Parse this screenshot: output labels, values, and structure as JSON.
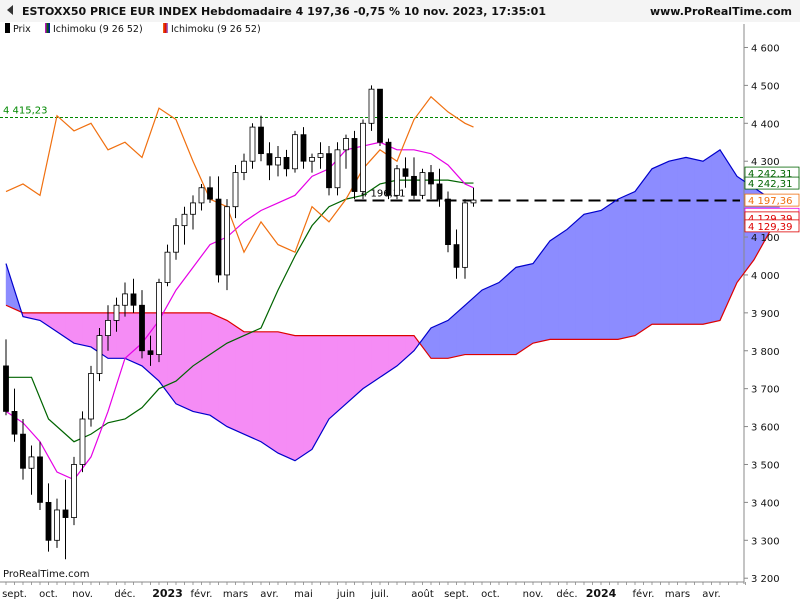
{
  "header": {
    "title": "ESTOXX50 PRICE EUR INDEX Hebdomadaire 4 197,36 -0,75 % 10 nov. 2023, 17:35:01",
    "brand": "www.ProRealTime.com"
  },
  "legend": [
    {
      "label": "Prix",
      "color": "#000000"
    },
    {
      "label": "Ichimoku (9 26 52)",
      "color": "#8a2be2"
    },
    {
      "label": "Ichimoku (9 26 52)",
      "color": "#8a2be2"
    }
  ],
  "footer": {
    "platform": "ProRealTime.com"
  },
  "colors": {
    "tenkan": "#e600e6",
    "kijun": "#006400",
    "chikou": "#f07010",
    "span_a": "#0000cc",
    "span_b": "#dd0000",
    "cloud_bull": "#8c8cff",
    "cloud_bear": "#f58cf5",
    "up_candle": "#ffffff",
    "down_candle": "#000000",
    "ref_line": "#008800"
  },
  "chart_data": {
    "type": "candlestick",
    "ylim": [
      3190,
      4625
    ],
    "y_ticks": [
      "4 600",
      "4 500",
      "4 400",
      "4 300",
      "4 200",
      "4 100",
      "4 000",
      "3 900",
      "3 800",
      "3 700",
      "3 600",
      "3 500",
      "3 400",
      "3 300",
      "3 200"
    ],
    "x_labels": [
      {
        "label": "sept.",
        "bar": 1,
        "bold": false
      },
      {
        "label": "oct.",
        "bar": 5,
        "bold": false
      },
      {
        "label": "nov.",
        "bar": 9,
        "bold": false
      },
      {
        "label": "déc.",
        "bar": 14,
        "bold": false
      },
      {
        "label": "2023",
        "bar": 19,
        "bold": true
      },
      {
        "label": "févr.",
        "bar": 23,
        "bold": false
      },
      {
        "label": "mars",
        "bar": 27,
        "bold": false
      },
      {
        "label": "avr.",
        "bar": 31,
        "bold": false
      },
      {
        "label": "mai",
        "bar": 35,
        "bold": false
      },
      {
        "label": "juin",
        "bar": 40,
        "bold": false
      },
      {
        "label": "juil.",
        "bar": 44,
        "bold": false
      },
      {
        "label": "août",
        "bar": 49,
        "bold": false
      },
      {
        "label": "sept.",
        "bar": 53,
        "bold": false
      },
      {
        "label": "oct.",
        "bar": 57,
        "bold": false
      },
      {
        "label": "nov.",
        "bar": 62,
        "bold": false
      },
      {
        "label": "déc.",
        "bar": 66,
        "bold": false
      },
      {
        "label": "2024",
        "bar": 70,
        "bold": true
      },
      {
        "label": "févr.",
        "bar": 75,
        "bold": false
      },
      {
        "label": "mars",
        "bar": 79,
        "bold": false
      },
      {
        "label": "avr.",
        "bar": 83,
        "bold": false
      }
    ],
    "ohlc": [
      [
        3760,
        3830,
        3630,
        3640
      ],
      [
        3640,
        3700,
        3560,
        3580
      ],
      [
        3580,
        3620,
        3460,
        3490
      ],
      [
        3490,
        3550,
        3420,
        3520
      ],
      [
        3520,
        3560,
        3380,
        3400
      ],
      [
        3400,
        3450,
        3270,
        3300
      ],
      [
        3300,
        3410,
        3280,
        3380
      ],
      [
        3380,
        3460,
        3250,
        3360
      ],
      [
        3360,
        3520,
        3340,
        3500
      ],
      [
        3500,
        3640,
        3480,
        3620
      ],
      [
        3620,
        3760,
        3600,
        3740
      ],
      [
        3740,
        3860,
        3720,
        3840
      ],
      [
        3840,
        3920,
        3800,
        3880
      ],
      [
        3880,
        3940,
        3850,
        3920
      ],
      [
        3920,
        3980,
        3890,
        3950
      ],
      [
        3950,
        3990,
        3900,
        3920
      ],
      [
        3920,
        3960,
        3780,
        3800
      ],
      [
        3800,
        3840,
        3760,
        3790
      ],
      [
        3790,
        3990,
        3770,
        3980
      ],
      [
        3980,
        4080,
        3970,
        4060
      ],
      [
        4060,
        4150,
        4040,
        4130
      ],
      [
        4130,
        4180,
        4080,
        4160
      ],
      [
        4160,
        4210,
        4120,
        4190
      ],
      [
        4190,
        4240,
        4170,
        4230
      ],
      [
        4230,
        4260,
        4190,
        4200
      ],
      [
        4200,
        4260,
        3980,
        4000
      ],
      [
        4000,
        4200,
        3960,
        4180
      ],
      [
        4180,
        4290,
        4150,
        4270
      ],
      [
        4270,
        4320,
        4250,
        4300
      ],
      [
        4300,
        4400,
        4280,
        4390
      ],
      [
        4390,
        4420,
        4300,
        4320
      ],
      [
        4320,
        4350,
        4250,
        4290
      ],
      [
        4290,
        4340,
        4260,
        4310
      ],
      [
        4310,
        4330,
        4260,
        4280
      ],
      [
        4280,
        4380,
        4270,
        4370
      ],
      [
        4370,
        4390,
        4280,
        4300
      ],
      [
        4300,
        4320,
        4270,
        4310
      ],
      [
        4310,
        4350,
        4280,
        4320
      ],
      [
        4320,
        4340,
        4210,
        4230
      ],
      [
        4230,
        4350,
        4210,
        4330
      ],
      [
        4330,
        4370,
        4280,
        4360
      ],
      [
        4360,
        4380,
        4200,
        4220
      ],
      [
        4220,
        4410,
        4200,
        4400
      ],
      [
        4400,
        4500,
        4380,
        4490
      ],
      [
        4490,
        4490,
        4340,
        4350
      ],
      [
        4350,
        4360,
        4200,
        4210
      ],
      [
        4210,
        4290,
        4200,
        4280
      ],
      [
        4280,
        4310,
        4230,
        4260
      ],
      [
        4260,
        4310,
        4200,
        4210
      ],
      [
        4210,
        4280,
        4200,
        4270
      ],
      [
        4270,
        4290,
        4200,
        4240
      ],
      [
        4240,
        4280,
        4180,
        4200
      ],
      [
        4200,
        4220,
        4060,
        4080
      ],
      [
        4080,
        4120,
        3990,
        4020
      ],
      [
        4020,
        4200,
        3990,
        4190
      ],
      [
        4190,
        4230,
        4180,
        4197.36
      ]
    ],
    "tenkan": [
      [
        0,
        3640
      ],
      [
        2,
        3610
      ],
      [
        4,
        3560
      ],
      [
        6,
        3480
      ],
      [
        8,
        3460
      ],
      [
        10,
        3520
      ],
      [
        12,
        3640
      ],
      [
        14,
        3780
      ],
      [
        16,
        3820
      ],
      [
        18,
        3880
      ],
      [
        20,
        3960
      ],
      [
        22,
        4020
      ],
      [
        24,
        4080
      ],
      [
        26,
        4100
      ],
      [
        28,
        4140
      ],
      [
        30,
        4170
      ],
      [
        32,
        4190
      ],
      [
        34,
        4210
      ],
      [
        36,
        4260
      ],
      [
        38,
        4280
      ],
      [
        40,
        4330
      ],
      [
        42,
        4340
      ],
      [
        44,
        4350
      ],
      [
        46,
        4330
      ],
      [
        48,
        4330
      ],
      [
        50,
        4320
      ],
      [
        52,
        4290
      ],
      [
        54,
        4240
      ],
      [
        55,
        4230
      ]
    ],
    "kijun": [
      [
        0,
        3730
      ],
      [
        3,
        3730
      ],
      [
        5,
        3620
      ],
      [
        8,
        3560
      ],
      [
        10,
        3580
      ],
      [
        12,
        3610
      ],
      [
        14,
        3620
      ],
      [
        16,
        3650
      ],
      [
        18,
        3700
      ],
      [
        20,
        3720
      ],
      [
        22,
        3760
      ],
      [
        24,
        3790
      ],
      [
        26,
        3820
      ],
      [
        28,
        3840
      ],
      [
        30,
        3860
      ],
      [
        32,
        3960
      ],
      [
        34,
        4050
      ],
      [
        36,
        4130
      ],
      [
        38,
        4180
      ],
      [
        40,
        4200
      ],
      [
        42,
        4210
      ],
      [
        44,
        4240
      ],
      [
        46,
        4250
      ],
      [
        48,
        4250
      ],
      [
        50,
        4250
      ],
      [
        52,
        4250
      ],
      [
        54,
        4242.31
      ],
      [
        55,
        4242.31
      ]
    ],
    "chikou": [
      [
        0,
        4220
      ],
      [
        2,
        4240
      ],
      [
        4,
        4210
      ],
      [
        6,
        4420
      ],
      [
        8,
        4380
      ],
      [
        10,
        4400
      ],
      [
        12,
        4330
      ],
      [
        14,
        4350
      ],
      [
        16,
        4310
      ],
      [
        18,
        4440
      ],
      [
        20,
        4410
      ],
      [
        22,
        4300
      ],
      [
        24,
        4200
      ],
      [
        26,
        4180
      ],
      [
        28,
        4060
      ],
      [
        30,
        4140
      ],
      [
        32,
        4080
      ],
      [
        34,
        4060
      ],
      [
        36,
        4180
      ],
      [
        38,
        4140
      ],
      [
        40,
        4200
      ],
      [
        42,
        4280
      ],
      [
        44,
        4330
      ],
      [
        46,
        4300
      ],
      [
        48,
        4410
      ],
      [
        50,
        4470
      ],
      [
        52,
        4430
      ],
      [
        54,
        4400
      ],
      [
        55,
        4390
      ]
    ],
    "span_a": [
      [
        0,
        4030
      ],
      [
        2,
        3890
      ],
      [
        4,
        3880
      ],
      [
        6,
        3850
      ],
      [
        8,
        3820
      ],
      [
        10,
        3810
      ],
      [
        12,
        3780
      ],
      [
        14,
        3780
      ],
      [
        16,
        3760
      ],
      [
        18,
        3720
      ],
      [
        20,
        3660
      ],
      [
        22,
        3640
      ],
      [
        24,
        3630
      ],
      [
        26,
        3600
      ],
      [
        28,
        3580
      ],
      [
        30,
        3560
      ],
      [
        32,
        3530
      ],
      [
        34,
        3510
      ],
      [
        36,
        3540
      ],
      [
        38,
        3620
      ],
      [
        40,
        3660
      ],
      [
        42,
        3700
      ],
      [
        44,
        3730
      ],
      [
        46,
        3760
      ],
      [
        48,
        3800
      ],
      [
        50,
        3860
      ],
      [
        52,
        3880
      ],
      [
        54,
        3920
      ],
      [
        56,
        3960
      ],
      [
        58,
        3980
      ],
      [
        60,
        4020
      ],
      [
        62,
        4030
      ],
      [
        64,
        4090
      ],
      [
        66,
        4120
      ],
      [
        68,
        4160
      ],
      [
        70,
        4170
      ],
      [
        72,
        4200
      ],
      [
        74,
        4220
      ],
      [
        76,
        4280
      ],
      [
        78,
        4300
      ],
      [
        80,
        4310
      ],
      [
        82,
        4300
      ],
      [
        84,
        4330
      ],
      [
        86,
        4260
      ],
      [
        88,
        4230
      ],
      [
        90,
        4200
      ],
      [
        91,
        4197
      ]
    ],
    "span_b": [
      [
        0,
        3920
      ],
      [
        2,
        3900
      ],
      [
        4,
        3900
      ],
      [
        6,
        3900
      ],
      [
        8,
        3900
      ],
      [
        10,
        3900
      ],
      [
        12,
        3900
      ],
      [
        14,
        3900
      ],
      [
        16,
        3900
      ],
      [
        18,
        3900
      ],
      [
        20,
        3900
      ],
      [
        22,
        3900
      ],
      [
        24,
        3900
      ],
      [
        26,
        3880
      ],
      [
        28,
        3850
      ],
      [
        30,
        3850
      ],
      [
        32,
        3850
      ],
      [
        34,
        3840
      ],
      [
        36,
        3840
      ],
      [
        38,
        3840
      ],
      [
        40,
        3840
      ],
      [
        42,
        3840
      ],
      [
        44,
        3840
      ],
      [
        46,
        3840
      ],
      [
        48,
        3840
      ],
      [
        50,
        3780
      ],
      [
        52,
        3780
      ],
      [
        54,
        3790
      ],
      [
        56,
        3790
      ],
      [
        58,
        3790
      ],
      [
        60,
        3790
      ],
      [
        62,
        3820
      ],
      [
        64,
        3830
      ],
      [
        66,
        3830
      ],
      [
        68,
        3830
      ],
      [
        70,
        3830
      ],
      [
        72,
        3830
      ],
      [
        74,
        3840
      ],
      [
        76,
        3870
      ],
      [
        78,
        3870
      ],
      [
        80,
        3870
      ],
      [
        82,
        3870
      ],
      [
        84,
        3880
      ],
      [
        86,
        3980
      ],
      [
        88,
        4040
      ],
      [
        90,
        4120
      ],
      [
        91,
        4160
      ]
    ],
    "ref_line": {
      "value": 4415.23,
      "label": "4 415,23"
    },
    "dashed_level": {
      "value": 4196.31,
      "label": "4 196,31"
    },
    "price_tags": [
      {
        "label": "4 242,31",
        "value": 4242.31,
        "color": "#006400",
        "y_offset": -10
      },
      {
        "label": "4 242,31",
        "value": 4242.31,
        "color": "#006400",
        "y_offset": 0
      },
      {
        "label": "4 197,36",
        "value": 4197.36,
        "color": "#f07010",
        "y_offset": 0
      },
      {
        "label": "4 160,00",
        "value": 4160.0,
        "color": "#e600e6",
        "y_offset": 0
      },
      {
        "label": "4 129,39",
        "value": 4129.39,
        "color": "#dd0000",
        "y_offset": -8
      },
      {
        "label": "4 129,39",
        "value": 4129.39,
        "color": "#dd0000",
        "y_offset": 0
      }
    ]
  }
}
